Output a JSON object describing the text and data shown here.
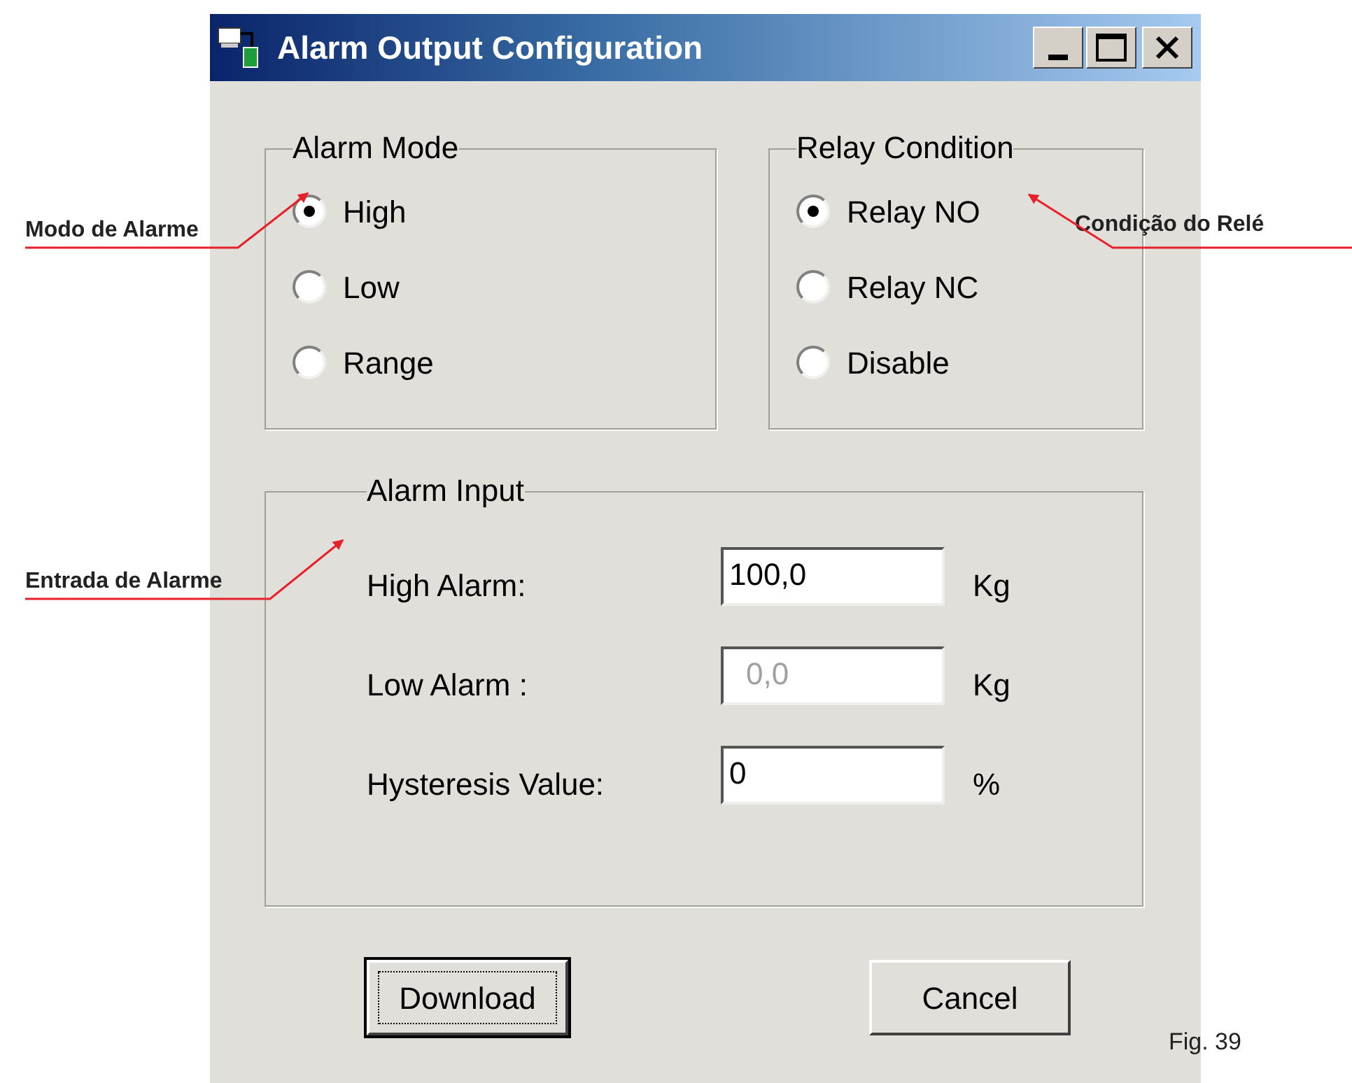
{
  "window": {
    "title": "Alarm Output Configuration"
  },
  "alarm_mode": {
    "title": "Alarm Mode",
    "options": [
      {
        "label": "High",
        "selected": true
      },
      {
        "label": "Low",
        "selected": false
      },
      {
        "label": "Range",
        "selected": false
      }
    ]
  },
  "relay_condition": {
    "title": "Relay Condition",
    "options": [
      {
        "label": "Relay NO",
        "selected": true
      },
      {
        "label": "Relay NC",
        "selected": false
      },
      {
        "label": "Disable",
        "selected": false
      }
    ]
  },
  "alarm_input": {
    "title": "Alarm Input",
    "fields": [
      {
        "label": "High Alarm:",
        "value": "100,0",
        "unit": "Kg",
        "disabled": false
      },
      {
        "label": "Low Alarm :",
        "value": "0,0",
        "unit": "Kg",
        "disabled": true
      },
      {
        "label": "Hysteresis Value:",
        "value": "0",
        "unit": "%",
        "disabled": false
      }
    ]
  },
  "buttons": [
    {
      "label": "Download",
      "focused": true
    },
    {
      "label": "Cancel",
      "focused": false
    }
  ],
  "annotations": [
    {
      "label": "Modo de Alarme"
    },
    {
      "label": "Condição do Relé"
    },
    {
      "label": "Entrada de Alarme"
    }
  ],
  "figure_caption": "Fig. 39"
}
